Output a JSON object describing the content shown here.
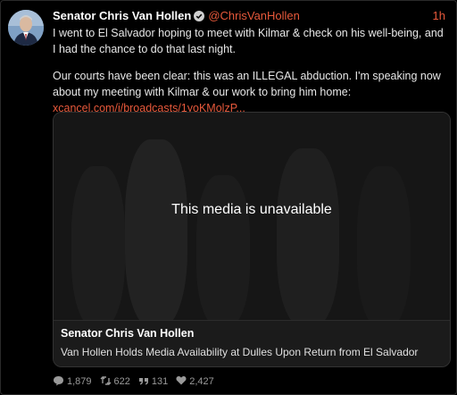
{
  "tweet": {
    "author_name": "Senator Chris Van Hollen",
    "handle": "@ChrisVanHollen",
    "time": "1h",
    "paragraph1": "I went to El Salvador hoping to meet with Kilmar & check on his well-being, and I had the chance to do that last night.",
    "paragraph2": "Our courts have been clear: this was an ILLEGAL abduction. I'm speaking now about my meeting with Kilmar & our work to bring him home: ",
    "link_text": "xcancel.com/i/broadcasts/1yoKMolzP..."
  },
  "media": {
    "status": "This media is unavailable",
    "card_title": "Senator Chris Van Hollen",
    "card_description": "Van Hollen Holds Media Availability at Dulles Upon Return from El Salvador"
  },
  "stats": {
    "replies": "1,879",
    "retweets": "622",
    "quotes": "131",
    "likes": "2,427"
  },
  "colors": {
    "accent": "#e8593b",
    "background": "#000000"
  },
  "icons": [
    "verified-icon",
    "reply-icon",
    "retweet-icon",
    "quote-icon",
    "like-icon"
  ]
}
